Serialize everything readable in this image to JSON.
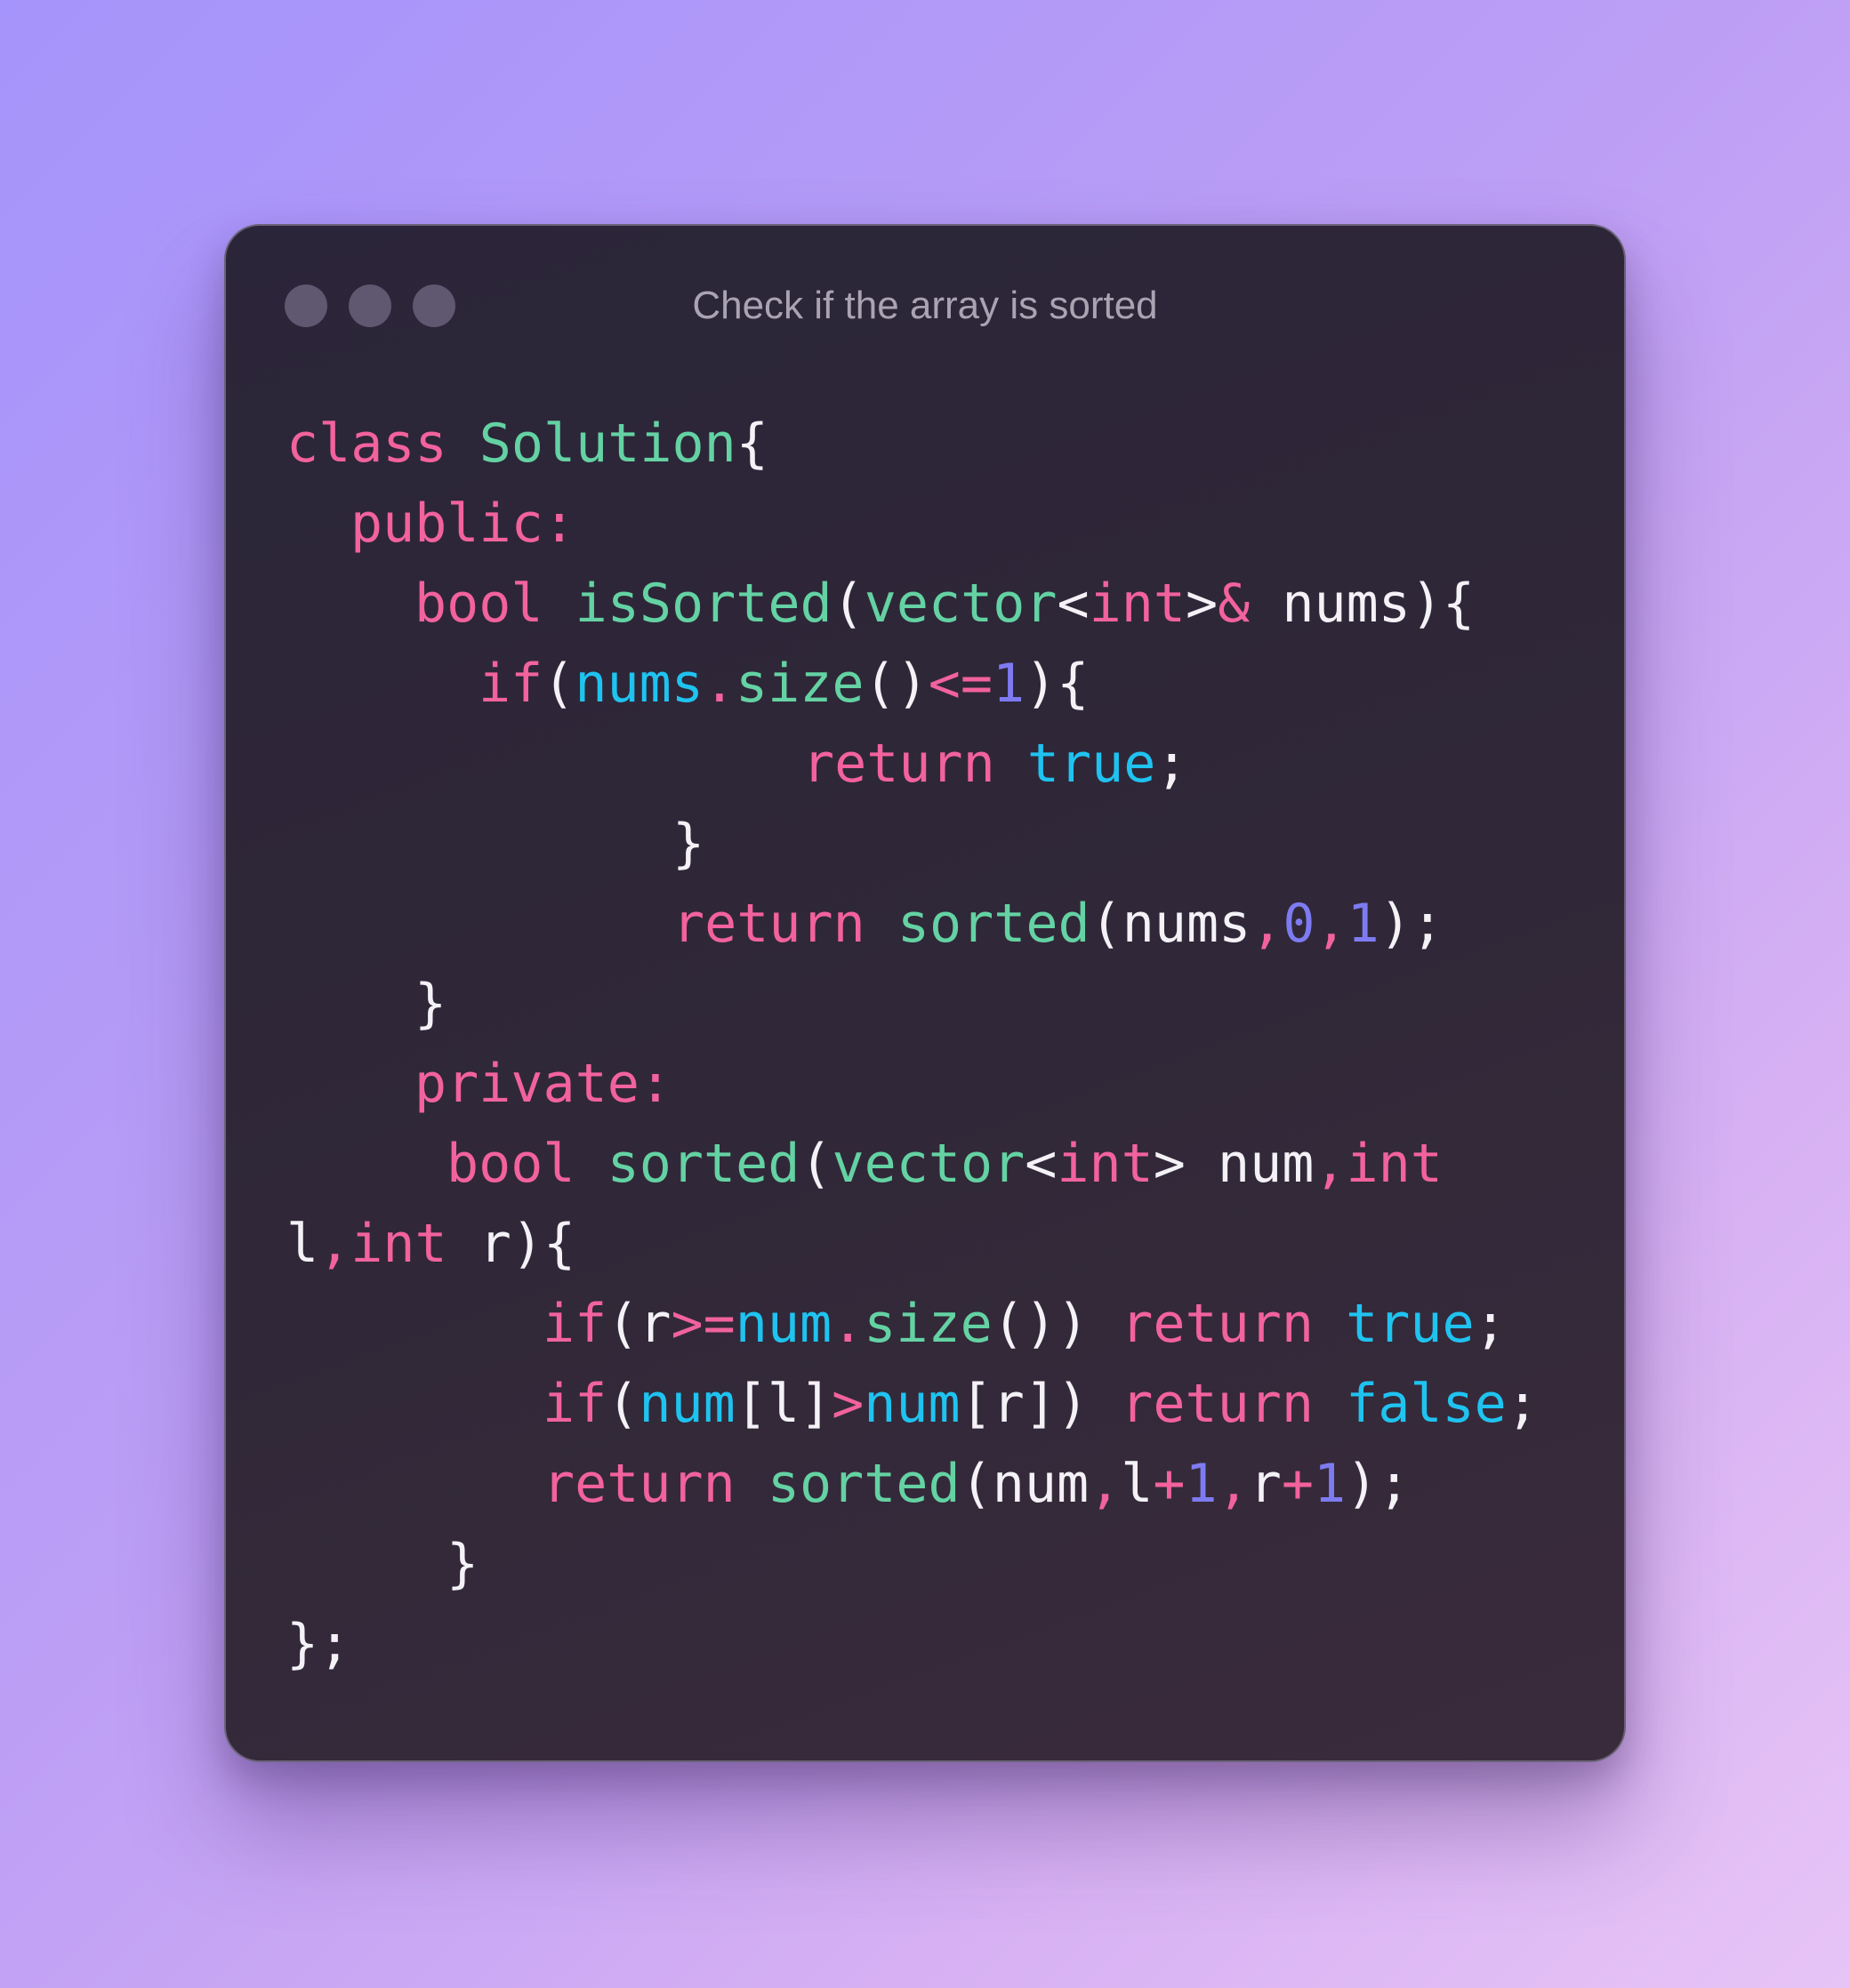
{
  "window": {
    "title": "Check if the array is sorted",
    "controls": [
      "window-dot",
      "window-dot",
      "window-dot"
    ]
  },
  "code": {
    "lines": [
      [
        [
          "kw",
          "class "
        ],
        [
          "fn",
          "Solution"
        ],
        [
          "pl",
          "{"
        ]
      ],
      [
        [
          "kw",
          "public:"
        ]
      ],
      [
        [
          "kw",
          "bool "
        ],
        [
          "fn",
          "isSorted"
        ],
        [
          "pl",
          "("
        ],
        [
          "fn",
          "vector"
        ],
        [
          "pl",
          "<"
        ],
        [
          "kw",
          "int"
        ],
        [
          "pl",
          ">"
        ],
        [
          "kw",
          "&"
        ],
        [
          "pl",
          " nums){"
        ]
      ],
      [
        [
          "kw",
          "if"
        ],
        [
          "pl",
          "("
        ],
        [
          "vr",
          "nums"
        ],
        [
          "kw",
          "."
        ],
        [
          "fn",
          "size"
        ],
        [
          "pl",
          "()"
        ],
        [
          "kw",
          "<="
        ],
        [
          "nm",
          "1"
        ],
        [
          "pl",
          "){"
        ]
      ],
      [
        [
          "kw",
          "return "
        ],
        [
          "vr",
          "true"
        ],
        [
          "pl",
          ";"
        ]
      ],
      [
        [
          "pl",
          "}"
        ]
      ],
      [
        [
          "kw",
          "return "
        ],
        [
          "fn",
          "sorted"
        ],
        [
          "pl",
          "(nums"
        ],
        [
          "kw",
          ","
        ],
        [
          "nm",
          "0"
        ],
        [
          "kw",
          ","
        ],
        [
          "nm",
          "1"
        ],
        [
          "pl",
          ");"
        ]
      ],
      [
        [
          "pl",
          "}"
        ]
      ],
      [
        [
          "kw",
          "private:"
        ]
      ],
      [
        [
          "kw",
          "bool "
        ],
        [
          "fn",
          "sorted"
        ],
        [
          "pl",
          "("
        ],
        [
          "fn",
          "vector"
        ],
        [
          "pl",
          "<"
        ],
        [
          "kw",
          "int"
        ],
        [
          "pl",
          "> num"
        ],
        [
          "kw",
          ",int"
        ]
      ],
      [
        [
          "pl",
          "l"
        ],
        [
          "kw",
          ",int"
        ],
        [
          "pl",
          " r){"
        ]
      ],
      [
        [
          "kw",
          "if"
        ],
        [
          "pl",
          "(r"
        ],
        [
          "kw",
          ">="
        ],
        [
          "vr",
          "num"
        ],
        [
          "kw",
          "."
        ],
        [
          "fn",
          "size"
        ],
        [
          "pl",
          "()) "
        ],
        [
          "kw",
          "return "
        ],
        [
          "vr",
          "true"
        ],
        [
          "pl",
          ";"
        ]
      ],
      [
        [
          "kw",
          "if"
        ],
        [
          "pl",
          "("
        ],
        [
          "vr",
          "num"
        ],
        [
          "pl",
          "[l]"
        ],
        [
          "kw",
          ">"
        ],
        [
          "vr",
          "num"
        ],
        [
          "pl",
          "[r]) "
        ],
        [
          "kw",
          "return "
        ],
        [
          "vr",
          "false"
        ],
        [
          "pl",
          ";"
        ]
      ],
      [
        [
          "kw",
          "return "
        ],
        [
          "fn",
          "sorted"
        ],
        [
          "pl",
          "(num"
        ],
        [
          "kw",
          ","
        ],
        [
          "pl",
          "l"
        ],
        [
          "kw",
          "+"
        ],
        [
          "nm",
          "1"
        ],
        [
          "kw",
          ","
        ],
        [
          "pl",
          "r"
        ],
        [
          "kw",
          "+"
        ],
        [
          "nm",
          "1"
        ],
        [
          "pl",
          ");"
        ]
      ],
      [
        [
          "pl",
          "}"
        ]
      ],
      [
        [
          "pl",
          "};"
        ]
      ]
    ]
  }
}
